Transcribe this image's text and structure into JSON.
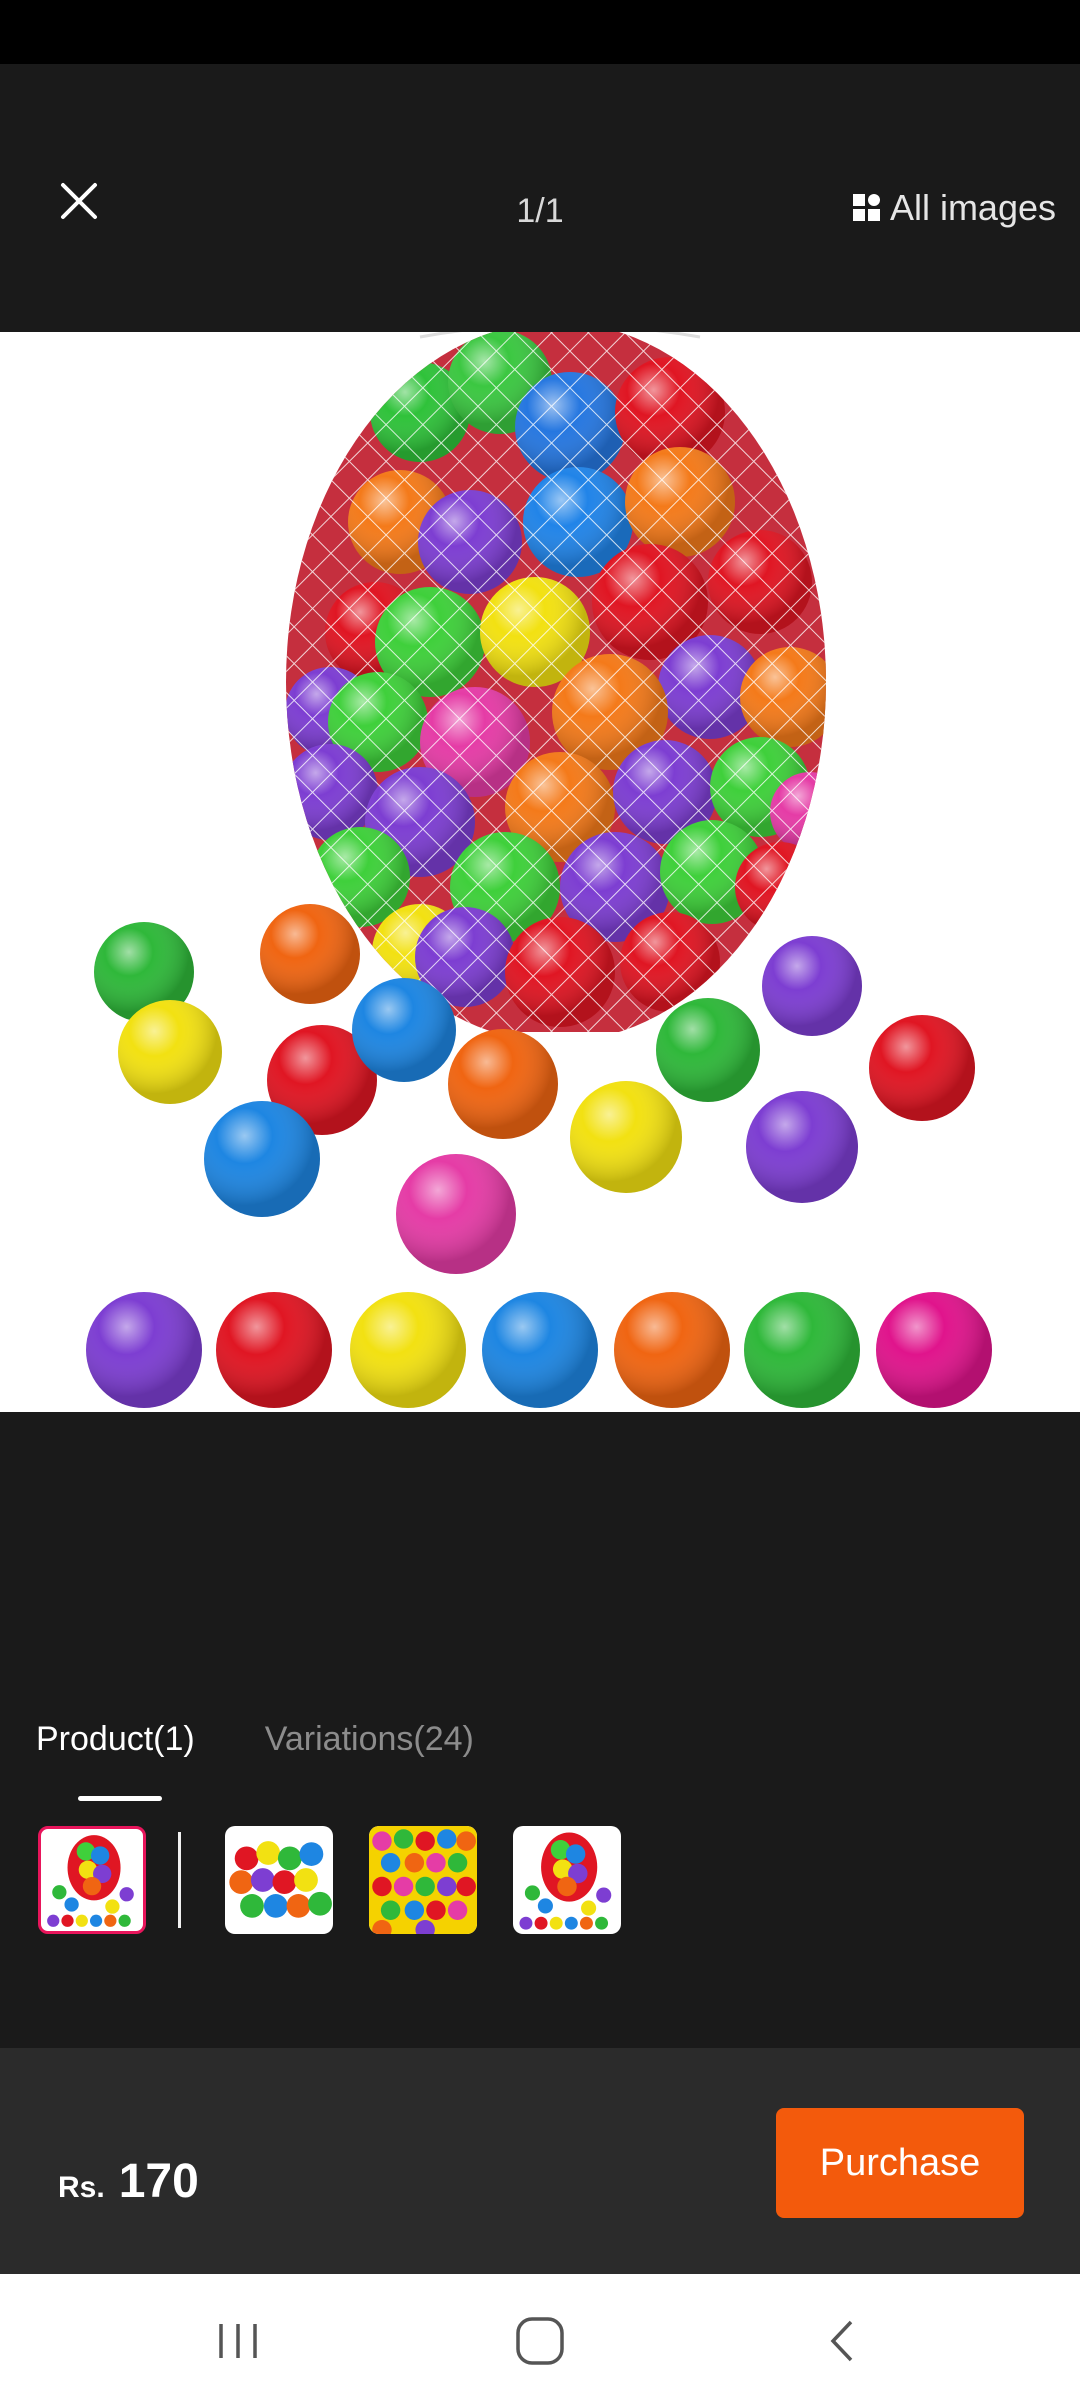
{
  "header": {
    "counter": "1/1",
    "all_images_label": "All images"
  },
  "tabs": [
    {
      "label": "Product(1)",
      "active": true
    },
    {
      "label": "Variations(24)",
      "active": false
    }
  ],
  "thumbnails": [
    {
      "selected": true
    },
    {
      "selected": false
    },
    {
      "selected": false
    },
    {
      "selected": false
    }
  ],
  "price": {
    "currency": "Rs.",
    "value": "170"
  },
  "purchase_label": "Purchase",
  "colors": {
    "accent": "#f35a0c",
    "selected_border": "#e8155b",
    "background": "#1a1a1a"
  }
}
